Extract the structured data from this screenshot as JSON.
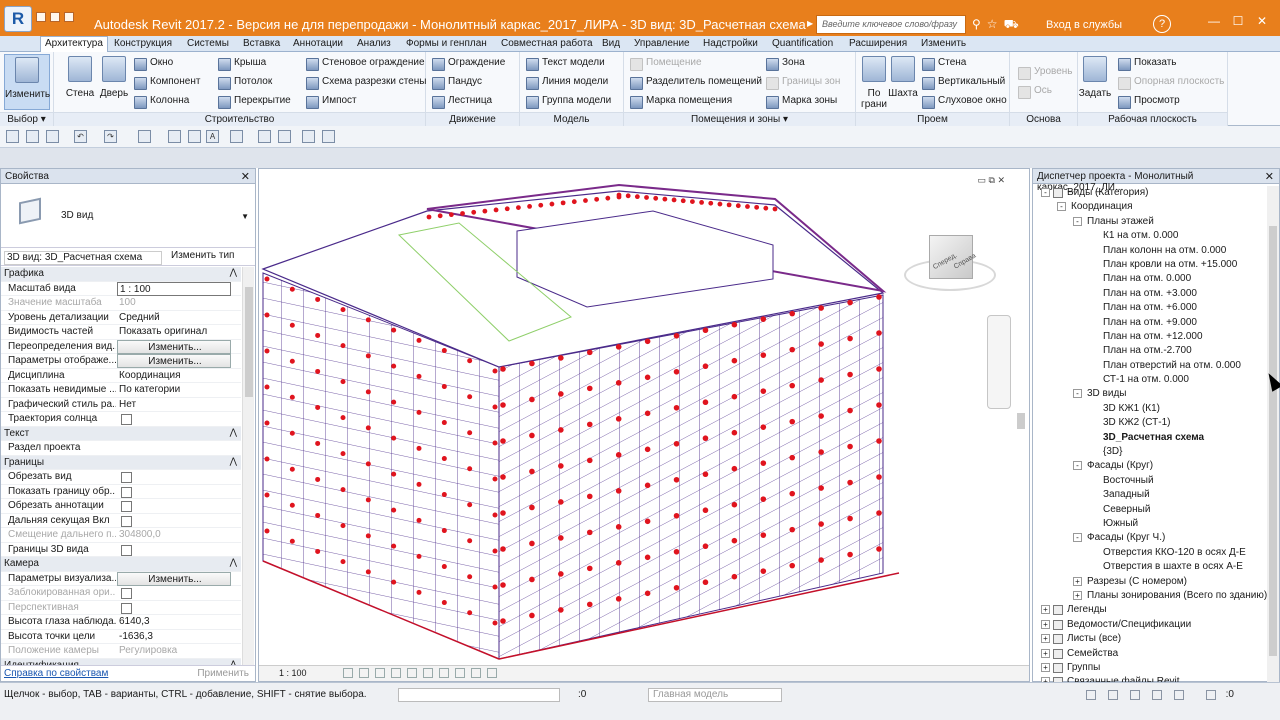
{
  "titlebar": {
    "app_icon": "R",
    "title": "Autodesk Revit 2017.2 - Версия не для перепродажи -    Монолитный каркас_2017_ЛИРА - 3D вид: 3D_Расчетная схема",
    "search_placeholder": "Введите ключевое слово/фразу",
    "login_label": "Вход в службы",
    "help_label": "?",
    "icons": [
      "binoculars-icon",
      "star-icon",
      "cart-icon",
      "exchange-icon",
      "user-icon"
    ]
  },
  "tabs": [
    "Архитектура",
    "Конструкция",
    "Системы",
    "Вставка",
    "Аннотации",
    "Анализ",
    "Формы и генплан",
    "Совместная работа",
    "Вид",
    "Управление",
    "Надстройки",
    "Quantification",
    "Расширения",
    "Изменить"
  ],
  "ribbon": {
    "select": {
      "modify": "Изменить",
      "label": "Выбор ▾"
    },
    "build": {
      "label": "Строительство",
      "big": [
        "Стена",
        "Дверь"
      ],
      "col1": [
        "Окно",
        "Компонент",
        "Колонна"
      ],
      "col2": [
        "Крыша",
        "Потолок",
        "Перекрытие"
      ],
      "col3": [
        "Стеновое ограждение",
        "Схема разрезки стены",
        "Импост"
      ]
    },
    "circulation": {
      "label": "Движение",
      "items": [
        "Ограждение",
        "Пандус",
        "Лестница"
      ]
    },
    "model": {
      "label": "Модель",
      "items": [
        "Текст модели",
        "Линия модели",
        "Группа модели"
      ]
    },
    "rooms": {
      "label": "Помещения и зоны ▾",
      "col1": [
        "Помещение",
        "Разделитель помещений",
        "Марка помещения"
      ],
      "col2": [
        "Зона",
        "Границы зон",
        "Марка зоны"
      ]
    },
    "opening": {
      "label": "Проем",
      "big": [
        "По грани",
        "Шахта"
      ],
      "items": [
        "Стена",
        "Вертикальный",
        "Слуховое окно"
      ]
    },
    "datum": {
      "label": "Основа",
      "items": [
        "Уровень",
        "Ось"
      ]
    },
    "workplane": {
      "label": "Рабочая плоскость",
      "big": "Задать",
      "items": [
        "Показать",
        "Опорная плоскость",
        "Просмотр"
      ]
    }
  },
  "properties": {
    "title": "Свойства",
    "type_name": "3D вид",
    "view_selector": "3D вид: 3D_Расчетная схема",
    "edit_type": "Изменить тип",
    "rows": [
      {
        "g": "Графика"
      },
      {
        "k": "Масштаб вида",
        "v": "1 : 100",
        "t": "input"
      },
      {
        "k": "Значение масштаба",
        "v": "100",
        "d": true
      },
      {
        "k": "Уровень детализации",
        "v": "Средний"
      },
      {
        "k": "Видимость частей",
        "v": "Показать оригинал"
      },
      {
        "k": "Переопределения вид...",
        "v": "Изменить...",
        "t": "btn"
      },
      {
        "k": "Параметры отображе...",
        "v": "Изменить...",
        "t": "btn"
      },
      {
        "k": "Дисциплина",
        "v": "Координация"
      },
      {
        "k": "Показать невидимые ...",
        "v": "По категории"
      },
      {
        "k": "Графический стиль ра...",
        "v": "Нет"
      },
      {
        "k": "Траектория солнца",
        "v": "",
        "t": "chk"
      },
      {
        "g": "Текст"
      },
      {
        "k": "Раздел проекта",
        "v": ""
      },
      {
        "g": "Границы"
      },
      {
        "k": "Обрезать вид",
        "v": "",
        "t": "chk"
      },
      {
        "k": "Показать границу обр...",
        "v": "",
        "t": "chk"
      },
      {
        "k": "Обрезать аннотации",
        "v": "",
        "t": "chk"
      },
      {
        "k": "Дальняя секущая Вкл",
        "v": "",
        "t": "chk"
      },
      {
        "k": "Смещение дальнего п...",
        "v": "304800,0",
        "d": true
      },
      {
        "k": "Границы 3D вида",
        "v": "",
        "t": "chk"
      },
      {
        "g": "Камера"
      },
      {
        "k": "Параметры визуализа...",
        "v": "Изменить...",
        "t": "btn"
      },
      {
        "k": "Заблокированная ори...",
        "v": "",
        "t": "chk",
        "d": true
      },
      {
        "k": "Перспективная",
        "v": "",
        "t": "chk",
        "d": true
      },
      {
        "k": "Высота глаза наблюда...",
        "v": "6140,3"
      },
      {
        "k": "Высота точки цели",
        "v": "-1636,3"
      },
      {
        "k": "Положение камеры",
        "v": "Регулировка",
        "d": true
      },
      {
        "g": "Идентификация"
      }
    ],
    "help_link": "Справка по свойствам",
    "apply": "Применить"
  },
  "view": {
    "scale": "1 : 100"
  },
  "browser": {
    "title": "Диспетчер проекта - Монолитный каркас_2017_ЛИ...",
    "nodes": [
      {
        "l": 0,
        "t": "-",
        "txt": "Виды (Категория)"
      },
      {
        "l": 1,
        "t": "-",
        "txt": "Координация"
      },
      {
        "l": 2,
        "t": "-",
        "txt": "Планы этажей"
      },
      {
        "l": 3,
        "txt": "К1  на отм. 0.000"
      },
      {
        "l": 3,
        "txt": "План колонн на отм. 0.000"
      },
      {
        "l": 3,
        "txt": "План кровли на отм. +15.000"
      },
      {
        "l": 3,
        "txt": "План на отм. 0.000"
      },
      {
        "l": 3,
        "txt": "План на отм. +3.000"
      },
      {
        "l": 3,
        "txt": "План на отм. +6.000"
      },
      {
        "l": 3,
        "txt": "План на отм. +9.000"
      },
      {
        "l": 3,
        "txt": "План на отм. +12.000"
      },
      {
        "l": 3,
        "txt": "План на отм.-2.700"
      },
      {
        "l": 3,
        "txt": "План отверстий  на отм. 0.000"
      },
      {
        "l": 3,
        "txt": "СТ-1 на отм. 0.000"
      },
      {
        "l": 2,
        "t": "-",
        "txt": "3D виды"
      },
      {
        "l": 3,
        "txt": "3D КЖ1 (К1)"
      },
      {
        "l": 3,
        "txt": "3D КЖ2 (СТ-1)"
      },
      {
        "l": 3,
        "txt": "3D_Расчетная схема",
        "b": true
      },
      {
        "l": 3,
        "txt": "{3D}"
      },
      {
        "l": 2,
        "t": "-",
        "txt": "Фасады (Круг)"
      },
      {
        "l": 3,
        "txt": "Восточный"
      },
      {
        "l": 3,
        "txt": "Западный"
      },
      {
        "l": 3,
        "txt": "Северный"
      },
      {
        "l": 3,
        "txt": "Южный"
      },
      {
        "l": 2,
        "t": "-",
        "txt": "Фасады (Круг Ч.)"
      },
      {
        "l": 3,
        "txt": "Отверстия ККО-120 в осях Д-Е"
      },
      {
        "l": 3,
        "txt": "Отверстия в шахте в осях А-Е"
      },
      {
        "l": 2,
        "t": "+",
        "txt": "Разрезы (С номером)"
      },
      {
        "l": 2,
        "t": "+",
        "txt": "Планы зонирования (Всего по зданию)"
      },
      {
        "l": 0,
        "t": "+",
        "i": true,
        "txt": "Легенды"
      },
      {
        "l": 0,
        "t": "+",
        "i": true,
        "txt": "Ведомости/Спецификации"
      },
      {
        "l": 0,
        "t": "+",
        "i": true,
        "txt": "Листы (все)"
      },
      {
        "l": 0,
        "t": "+",
        "i": true,
        "txt": "Семейства"
      },
      {
        "l": 0,
        "t": "+",
        "i": true,
        "txt": "Группы"
      },
      {
        "l": 0,
        "t": "+",
        "i": true,
        "txt": "Связанные файлы Revit"
      }
    ]
  },
  "status": {
    "message": "Щелчок - выбор, TAB - варианты, CTRL - добавление, SHIFT - снятие выбора.",
    "select_count": ":0",
    "model": "Главная модель",
    "filter_count": ":0"
  }
}
